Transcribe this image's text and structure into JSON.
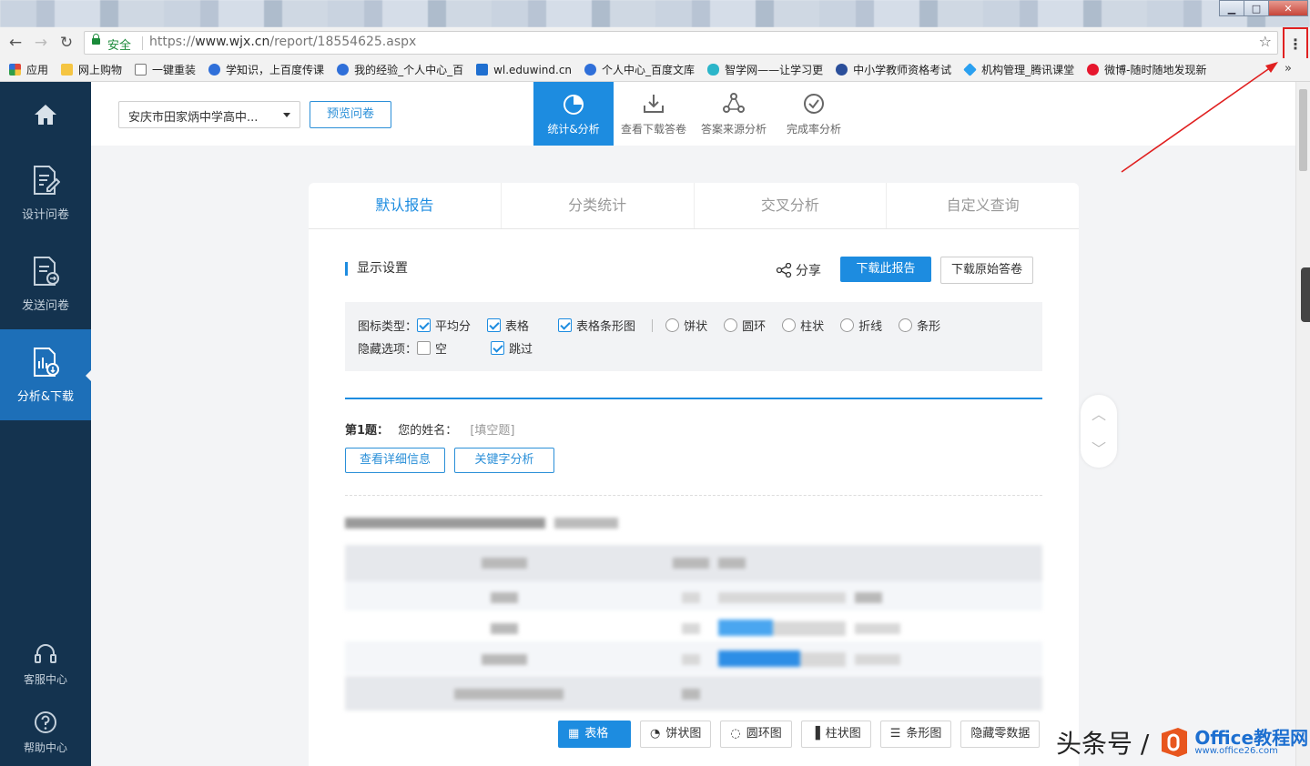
{
  "browser": {
    "window_controls": {
      "minimize": "▁",
      "maximize": "□",
      "close": "✕"
    },
    "address": {
      "secure_label": "安全",
      "url_prefix": "https://",
      "url_host": "www.wjx.cn",
      "url_path": "/report/18554625.aspx"
    },
    "bookmarks": [
      {
        "label": "应用",
        "icon": "apps-grid-icon",
        "color": "#e0463a"
      },
      {
        "label": "网上购物",
        "icon": "folder-icon",
        "color": "#f5c542"
      },
      {
        "label": "一键重装",
        "icon": "page-icon",
        "color": "#ffffff"
      },
      {
        "label": "学知识，上百度传课",
        "icon": "baidu-paw-icon",
        "color": "#2f6fd9"
      },
      {
        "label": "我的经验_个人中心_百",
        "icon": "baidu-paw-icon",
        "color": "#2f6fd9"
      },
      {
        "label": "wl.eduwind.cn",
        "icon": "ew-icon",
        "color": "#1f6fd0"
      },
      {
        "label": "个人中心_百度文库",
        "icon": "baidu-paw-icon",
        "color": "#2f6fd9"
      },
      {
        "label": "智学网——让学习更",
        "icon": "cloud-icon",
        "color": "#2bb5c9"
      },
      {
        "label": "中小学教师资格考试",
        "icon": "circle-badge-icon",
        "color": "#2a4e9a"
      },
      {
        "label": "机构管理_腾讯课堂",
        "icon": "diamond-icon",
        "color": "#2aa0f0"
      },
      {
        "label": "微博-随时随地发现新",
        "icon": "weibo-icon",
        "color": "#e6162d"
      }
    ],
    "bookmarks_more": "»"
  },
  "sidebar": {
    "home_icon": "home-icon",
    "items": [
      {
        "label": "设计问卷",
        "icon": "edit-doc-icon"
      },
      {
        "label": "发送问卷",
        "icon": "send-doc-icon"
      },
      {
        "label": "分析&下载",
        "icon": "chart-doc-icon"
      }
    ],
    "bottom": [
      {
        "label": "客服中心",
        "icon": "headset-icon"
      },
      {
        "label": "帮助中心",
        "icon": "help-icon"
      }
    ]
  },
  "toolbar": {
    "survey_select": "安庆市田家炳中学高中...",
    "preview_label": "预览问卷",
    "tools": [
      {
        "label": "统计&分析",
        "icon": "pie-chart-icon"
      },
      {
        "label": "查看下载答卷",
        "icon": "download-icon"
      },
      {
        "label": "答案来源分析",
        "icon": "network-icon"
      },
      {
        "label": "完成率分析",
        "icon": "check-circle-icon"
      }
    ]
  },
  "report": {
    "tabs": [
      "默认报告",
      "分类统计",
      "交叉分析",
      "自定义查询"
    ],
    "section_title": "显示设置",
    "share_label": "分享",
    "download_report_label": "下载此报告",
    "download_raw_label": "下载原始答卷",
    "options": {
      "chart_type_label": "图标类型：",
      "checks": [
        {
          "label": "平均分",
          "checked": true
        },
        {
          "label": "表格",
          "checked": true
        },
        {
          "label": "表格条形图",
          "checked": true
        }
      ],
      "radios": [
        "饼状",
        "圆环",
        "柱状",
        "折线",
        "条形"
      ],
      "hide_label": "隐藏选项：",
      "hide_checks": [
        {
          "label": "空",
          "checked": false
        },
        {
          "label": "跳过",
          "checked": true
        }
      ]
    },
    "question": {
      "number": "第1题：",
      "text": "您的姓名：",
      "type": "[填空题]",
      "detail_button": "查看详细信息",
      "keyword_button": "关键字分析"
    },
    "chart_buttons": [
      {
        "label": "表格",
        "icon": "table-icon",
        "glyph": "▦"
      },
      {
        "label": "饼状图",
        "icon": "pie-icon",
        "glyph": "◔"
      },
      {
        "label": "圆环图",
        "icon": "donut-icon",
        "glyph": "◌"
      },
      {
        "label": "柱状图",
        "icon": "bar-chart-icon",
        "glyph": "▐"
      },
      {
        "label": "条形图",
        "icon": "hbar-chart-icon",
        "glyph": "☰"
      },
      {
        "label": "隐藏零数据",
        "icon": "",
        "glyph": ""
      }
    ]
  },
  "scroll_nav": {
    "up": "︿",
    "down": "﹀"
  },
  "watermark": {
    "text": "头条号 /",
    "brand": "Office教程网",
    "site": "www.office26.com"
  }
}
